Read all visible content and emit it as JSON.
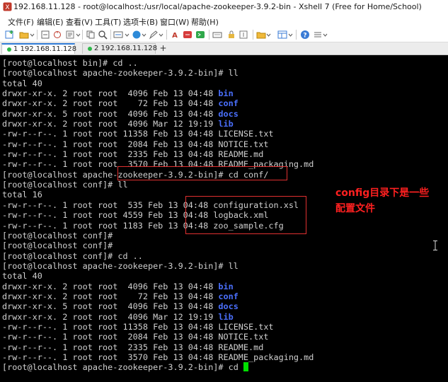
{
  "window": {
    "title": "192.168.11.128 - root@localhost:/usr/local/apache-zookeeper-3.9.2-bin - Xshell 7 (Free for Home/School)"
  },
  "menu": {
    "items": [
      "文件(F)",
      "编辑(E)",
      "查看(V)",
      "工具(T)",
      "选项卡(B)",
      "窗口(W)",
      "帮助(H)"
    ]
  },
  "toolbar": {
    "icons": [
      "new-session-icon",
      "open-folder-icon",
      "disconnect-icon",
      "reconnect-icon",
      "properties-icon",
      "copy-icon",
      "paste-icon",
      "find-icon",
      "encoding-icon",
      "font-icon",
      "color-scheme-icon",
      "compose-icon",
      "lock-icon",
      "keyboard-icon",
      "xftp-icon",
      "folder-icon",
      "layout-icon",
      "help-icon"
    ]
  },
  "tabs": [
    {
      "label": "1 192.168.11.128",
      "active": true,
      "dot_color": "#2fb84a"
    },
    {
      "label": "2 192.168.11.128",
      "active": false,
      "dot_color": "#2fb84a"
    }
  ],
  "tab_add": "+",
  "terminal": {
    "lines": [
      [
        {
          "t": "[root@localhost bin]# cd .."
        }
      ],
      [
        {
          "t": "[root@localhost apache-zookeeper-3.9.2-bin]# ll"
        }
      ],
      [
        {
          "t": "total 40"
        }
      ],
      [
        {
          "t": "drwxr-xr-x. 2 root root  4096 Feb 13 04:48 "
        },
        {
          "t": "bin",
          "dir": true
        }
      ],
      [
        {
          "t": "drwxr-xr-x. 2 root root    72 Feb 13 04:48 "
        },
        {
          "t": "conf",
          "dir": true
        }
      ],
      [
        {
          "t": "drwxr-xr-x. 5 root root  4096 Feb 13 04:48 "
        },
        {
          "t": "docs",
          "dir": true
        }
      ],
      [
        {
          "t": "drwxr-xr-x. 2 root root  4096 Mar 12 19:19 "
        },
        {
          "t": "lib",
          "dir": true
        }
      ],
      [
        {
          "t": "-rw-r--r--. 1 root root 11358 Feb 13 04:48 LICENSE.txt"
        }
      ],
      [
        {
          "t": "-rw-r--r--. 1 root root  2084 Feb 13 04:48 NOTICE.txt"
        }
      ],
      [
        {
          "t": "-rw-r--r--. 1 root root  2335 Feb 13 04:48 README.md"
        }
      ],
      [
        {
          "t": "-rw-r--r--. 1 root root  3570 Feb 13 04:48 README_packaging.md"
        }
      ],
      [
        {
          "t": "[root@localhost apache-zookeeper-3.9.2-bin]# cd conf/"
        }
      ],
      [
        {
          "t": "[root@localhost conf]# ll"
        }
      ],
      [
        {
          "t": "total 16"
        }
      ],
      [
        {
          "t": "-rw-r--r--. 1 root root  535 Feb 13 04:48 configuration.xsl"
        }
      ],
      [
        {
          "t": "-rw-r--r--. 1 root root 4559 Feb 13 04:48 logback.xml"
        }
      ],
      [
        {
          "t": "-rw-r--r--. 1 root root 1183 Feb 13 04:48 zoo_sample.cfg"
        }
      ],
      [
        {
          "t": "[root@localhost conf]#"
        }
      ],
      [
        {
          "t": "[root@localhost conf]#"
        }
      ],
      [
        {
          "t": "[root@localhost conf]# cd .."
        }
      ],
      [
        {
          "t": "[root@localhost apache-zookeeper-3.9.2-bin]# ll"
        }
      ],
      [
        {
          "t": "total 40"
        }
      ],
      [
        {
          "t": "drwxr-xr-x. 2 root root  4096 Feb 13 04:48 "
        },
        {
          "t": "bin",
          "dir": true
        }
      ],
      [
        {
          "t": "drwxr-xr-x. 2 root root    72 Feb 13 04:48 "
        },
        {
          "t": "conf",
          "dir": true
        }
      ],
      [
        {
          "t": "drwxr-xr-x. 5 root root  4096 Feb 13 04:48 "
        },
        {
          "t": "docs",
          "dir": true
        }
      ],
      [
        {
          "t": "drwxr-xr-x. 2 root root  4096 Mar 12 19:19 "
        },
        {
          "t": "lib",
          "dir": true
        }
      ],
      [
        {
          "t": "-rw-r--r--. 1 root root 11358 Feb 13 04:48 LICENSE.txt"
        }
      ],
      [
        {
          "t": "-rw-r--r--. 1 root root  2084 Feb 13 04:48 NOTICE.txt"
        }
      ],
      [
        {
          "t": "-rw-r--r--. 1 root root  2335 Feb 13 04:48 README.md"
        }
      ],
      [
        {
          "t": "-rw-r--r--. 1 root root  3570 Feb 13 04:48 README_packaging.md"
        }
      ],
      [
        {
          "t": "[root@localhost apache-zookeeper-3.9.2-bin]# cd "
        }
      ]
    ],
    "colors": {
      "background": "#000000",
      "text": "#d0d0d0",
      "directory": "#4a6ffb",
      "cursor": "#00e000"
    }
  },
  "annotation": {
    "text": "config目录下是一些\n配置文件",
    "color": "#ff2020"
  }
}
